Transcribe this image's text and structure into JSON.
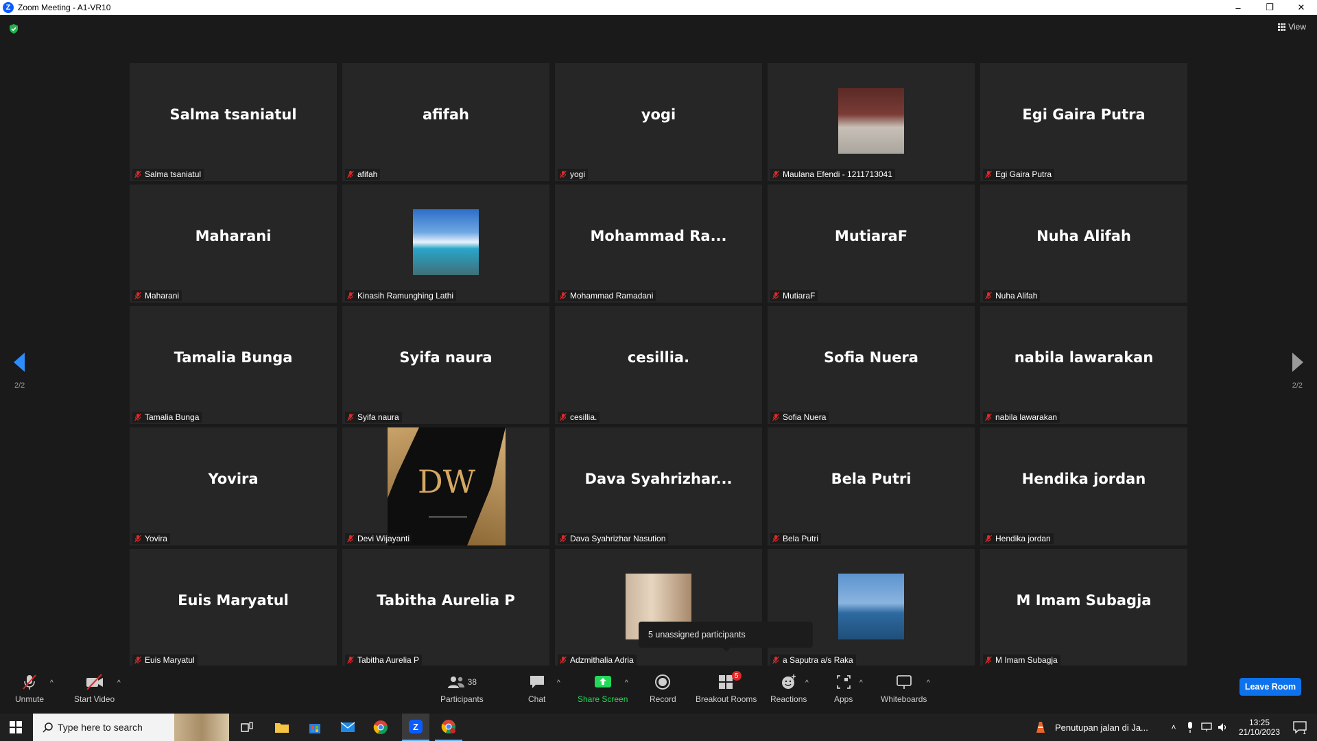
{
  "window": {
    "title": "Zoom Meeting - A1-VR10",
    "controls": {
      "minimize": "–",
      "restore": "❐",
      "close": "✕"
    }
  },
  "meeting": {
    "view_label": "View",
    "page_left": "2/2",
    "page_right": "2/2",
    "tooltip": "5 unassigned participants",
    "tiles": [
      {
        "big": "Salma tsaniatul",
        "tag": "Salma tsaniatul"
      },
      {
        "big": "afifah",
        "tag": "afifah"
      },
      {
        "big": "yogi",
        "tag": "yogi"
      },
      {
        "big": "",
        "tag": "Maulana Efendi - 1211713041",
        "photo": "p-maulana"
      },
      {
        "big": "Egi Gaira Putra",
        "tag": "Egi Gaira Putra"
      },
      {
        "big": "Maharani",
        "tag": "Maharani"
      },
      {
        "big": "",
        "tag": "Kinasih Ramunghing Lathi",
        "photo": "p-kinasih"
      },
      {
        "big": "Mohammad  Ra...",
        "tag": "Mohammad Ramadani"
      },
      {
        "big": "MutiaraF",
        "tag": "MutiaraF"
      },
      {
        "big": "Nuha Alifah",
        "tag": "Nuha Alifah"
      },
      {
        "big": "Tamalia Bunga",
        "tag": "Tamalia Bunga"
      },
      {
        "big": "Syifa naura",
        "tag": "Syifa naura"
      },
      {
        "big": "cesillia.",
        "tag": "cesillia."
      },
      {
        "big": "Sofia Nuera",
        "tag": "Sofia Nuera"
      },
      {
        "big": "nabila lawarakan",
        "tag": "nabila lawarakan"
      },
      {
        "big": "Yovira",
        "tag": "Yovira"
      },
      {
        "big": "",
        "tag": "Devi Wijayanti",
        "logo": "DW"
      },
      {
        "big": "Dava  Syahrizhar...",
        "tag": "Dava Syahrizhar Nasution"
      },
      {
        "big": "Bela Putri",
        "tag": "Bela Putri"
      },
      {
        "big": "Hendika jordan",
        "tag": "Hendika jordan"
      },
      {
        "big": "Euis Maryatul",
        "tag": "Euis Maryatul"
      },
      {
        "big": "Tabitha Aurelia P",
        "tag": "Tabitha Aurelia P"
      },
      {
        "big": "",
        "tag": "Adzmithalia Adria",
        "photo": "p-adzmit"
      },
      {
        "big": "",
        "tag": "a Saputra a/s Raka",
        "photo": "p-raka"
      },
      {
        "big": "M Imam Subagja",
        "tag": "M Imam Subagja"
      }
    ]
  },
  "toolbar": {
    "unmute": "Unmute",
    "start_video": "Start Video",
    "participants": "Participants",
    "participants_count": "38",
    "chat": "Chat",
    "share_screen": "Share Screen",
    "record": "Record",
    "breakout_rooms": "Breakout Rooms",
    "breakout_badge": "5",
    "reactions": "Reactions",
    "apps": "Apps",
    "whiteboards": "Whiteboards",
    "leave": "Leave Room",
    "colors": {
      "share": "#23d959",
      "leave": "#0e72ed",
      "badge": "#e02828"
    }
  },
  "taskbar": {
    "search_placeholder": "Type here to search",
    "news": "Penutupan jalan di Ja...",
    "time": "13:25",
    "date": "21/10/2023",
    "notif_count": "1"
  }
}
